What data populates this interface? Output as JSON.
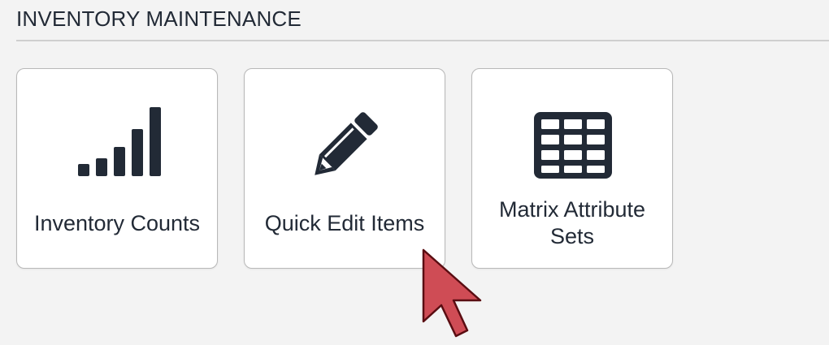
{
  "section": {
    "title": "INVENTORY MAINTENANCE"
  },
  "tiles": [
    {
      "label": "Inventory Counts",
      "icon": "signal-bars-icon"
    },
    {
      "label": "Quick Edit Items",
      "icon": "pencil-icon"
    },
    {
      "label": "Matrix Attribute Sets",
      "icon": "table-grid-icon"
    }
  ],
  "colors": {
    "background": "#f3f3f3",
    "tile_background": "#ffffff",
    "text": "#222a36",
    "icon": "#222a36",
    "divider": "#cfcfcf",
    "cursor_fill": "#cf4c55"
  }
}
